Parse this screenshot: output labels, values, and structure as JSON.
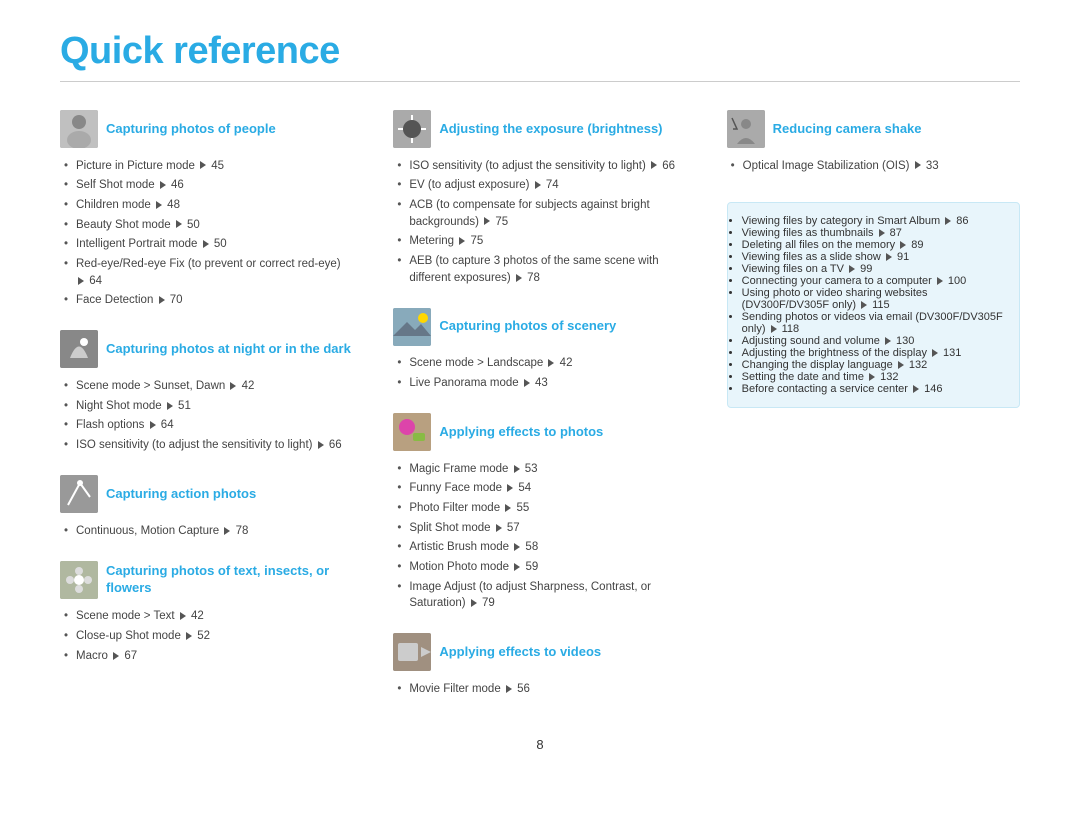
{
  "title": "Quick reference",
  "page_number": "8",
  "columns": [
    {
      "sections": [
        {
          "id": "people",
          "title": "Capturing photos of people",
          "icon": "person",
          "items": [
            "Picture in Picture mode ▶ 45",
            "Self Shot mode ▶ 46",
            "Children mode ▶ 48",
            "Beauty Shot mode ▶ 50",
            "Intelligent Portrait mode ▶ 50",
            "Red-eye/Red-eye Fix (to prevent or correct red-eye) ▶ 64",
            "Face Detection ▶ 70"
          ]
        },
        {
          "id": "night",
          "title": "Capturing photos at night or in the dark",
          "icon": "night",
          "items": [
            "Scene mode > Sunset, Dawn ▶ 42",
            "Night Shot mode ▶ 51",
            "Flash options ▶ 64",
            "ISO sensitivity (to adjust the sensitivity to light) ▶ 66"
          ]
        },
        {
          "id": "action",
          "title": "Capturing action photos",
          "icon": "action",
          "items": [
            "Continuous, Motion Capture ▶ 78"
          ]
        },
        {
          "id": "text",
          "title": "Capturing photos of text, insects, or flowers",
          "icon": "flower",
          "items": [
            "Scene mode > Text ▶ 42",
            "Close-up Shot mode ▶ 52",
            "Macro ▶ 67"
          ]
        }
      ]
    },
    {
      "sections": [
        {
          "id": "exposure",
          "title": "Adjusting the exposure (brightness)",
          "icon": "exposure",
          "items": [
            "ISO sensitivity (to adjust the sensitivity to light) ▶ 66",
            "EV (to adjust exposure) ▶ 74",
            "ACB (to compensate for subjects against bright backgrounds) ▶ 75",
            "Metering ▶ 75",
            "AEB (to capture 3 photos of the same scene with different exposures) ▶ 78"
          ]
        },
        {
          "id": "scenery",
          "title": "Capturing photos of scenery",
          "icon": "scenery",
          "items": [
            "Scene mode > Landscape ▶ 42",
            "Live Panorama mode ▶ 43"
          ]
        },
        {
          "id": "effects",
          "title": "Applying effects to photos",
          "icon": "effects",
          "items": [
            "Magic Frame mode ▶ 53",
            "Funny Face mode ▶ 54",
            "Photo Filter mode ▶ 55",
            "Split Shot mode ▶ 57",
            "Artistic Brush mode ▶ 58",
            "Motion Photo mode ▶ 59",
            "Image Adjust (to adjust Sharpness, Contrast, or Saturation) ▶ 79"
          ]
        },
        {
          "id": "video-effects",
          "title": "Applying effects to videos",
          "icon": "video",
          "items": [
            "Movie Filter mode ▶ 56"
          ]
        }
      ]
    },
    {
      "sections": [
        {
          "id": "shake",
          "title": "Reducing camera shake",
          "icon": "shake",
          "items": [
            "Optical Image Stabilization (OIS) ▶ 33"
          ]
        }
      ],
      "box": {
        "items": [
          "Viewing files by category in Smart Album ▶ 86",
          "Viewing files as thumbnails ▶ 87",
          "Deleting all files on the memory ▶ 89",
          "Viewing files as a slide show ▶ 91",
          "Viewing files on a TV ▶ 99",
          "Connecting your camera to a computer ▶ 100",
          "Using photo or video sharing websites (DV300F/DV305F only) ▶ 115",
          "Sending photos or videos via email (DV300F/DV305F only) ▶ 118",
          "Adjusting sound and volume ▶ 130",
          "Adjusting the brightness of the display ▶ 131",
          "Changing the display language ▶ 132",
          "Setting the date and time ▶ 132",
          "Before contacting a service center ▶ 146"
        ]
      }
    }
  ]
}
